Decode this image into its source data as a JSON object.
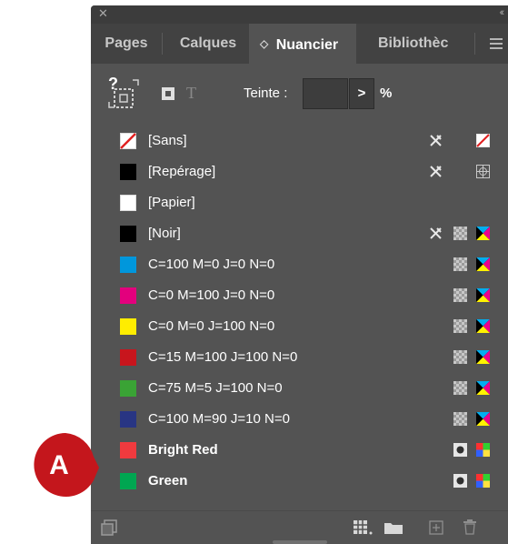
{
  "tabs": [
    {
      "label": "Pages",
      "active": false
    },
    {
      "label": "Calques",
      "active": false
    },
    {
      "label": "Nuancier",
      "active": true,
      "prefix": "◇"
    },
    {
      "label": "Bibliothèc",
      "active": false
    }
  ],
  "toolbar": {
    "tint_label": "Teinte :",
    "tint_value": "",
    "tint_arrow": ">",
    "percent": "%"
  },
  "swatches": [
    {
      "name": "[Sans]",
      "color": "#ffffff",
      "type": "none",
      "bold": false,
      "icons": [
        "no-edit",
        "none-type"
      ]
    },
    {
      "name": "[Repérage]",
      "color": "#000000",
      "type": "registration",
      "bold": false,
      "icons": [
        "no-edit",
        "registration-type"
      ]
    },
    {
      "name": "[Papier]",
      "color": "#ffffff",
      "type": "paper",
      "bold": false,
      "icons": []
    },
    {
      "name": "[Noir]",
      "color": "#000000",
      "type": "process",
      "bold": false,
      "icons": [
        "no-edit",
        "process-mode",
        "cmyk-mode"
      ]
    },
    {
      "name": "C=100 M=0 J=0 N=0",
      "color": "#0097dc",
      "type": "process",
      "bold": false,
      "icons": [
        "process-mode",
        "cmyk-mode"
      ]
    },
    {
      "name": "C=0 M=100 J=0 N=0",
      "color": "#e3007d",
      "type": "process",
      "bold": false,
      "icons": [
        "process-mode",
        "cmyk-mode"
      ]
    },
    {
      "name": "C=0 M=0 J=100 N=0",
      "color": "#ffed00",
      "type": "process",
      "bold": false,
      "icons": [
        "process-mode",
        "cmyk-mode"
      ]
    },
    {
      "name": "C=15 M=100 J=100 N=0",
      "color": "#c8151d",
      "type": "process",
      "bold": false,
      "icons": [
        "process-mode",
        "cmyk-mode"
      ]
    },
    {
      "name": "C=75 M=5 J=100 N=0",
      "color": "#3aa335",
      "type": "process",
      "bold": false,
      "icons": [
        "process-mode",
        "cmyk-mode"
      ]
    },
    {
      "name": "C=100 M=90 J=10 N=0",
      "color": "#283583",
      "type": "process",
      "bold": false,
      "icons": [
        "process-mode",
        "cmyk-mode"
      ]
    },
    {
      "name": "Bright Red",
      "color": "#f03a3e",
      "type": "spot",
      "bold": true,
      "icons": [
        "spot-mode",
        "rgb-mode"
      ]
    },
    {
      "name": "Green",
      "color": "#00a651",
      "type": "spot",
      "bold": true,
      "icons": [
        "spot-mode",
        "rgb-mode"
      ]
    }
  ],
  "callout": {
    "label": "A",
    "color": "#c4161c"
  },
  "colors": {
    "panel": "#535353",
    "tabbar": "#424242",
    "topbar": "#3c3c3c",
    "text": "#ffffff"
  }
}
